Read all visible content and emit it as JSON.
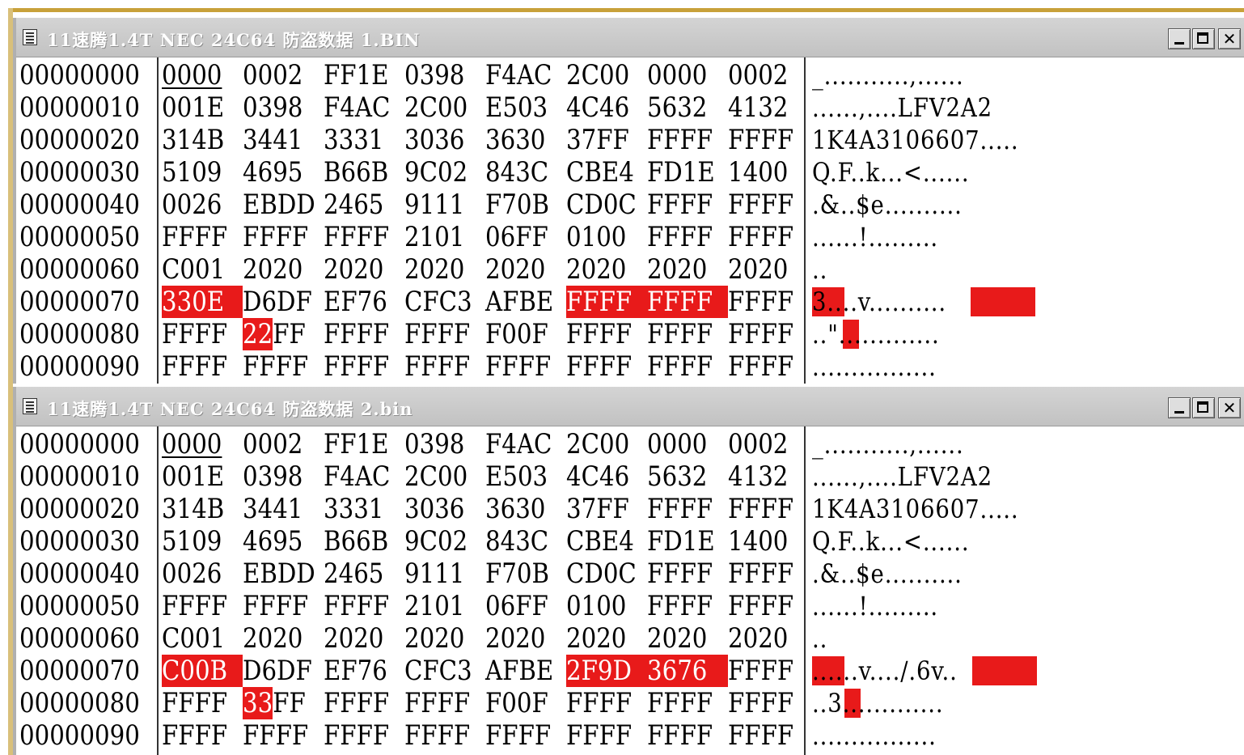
{
  "windows": [
    {
      "title": "11速腾1.4T NEC 24C64 防盗数据 1.BIN",
      "rows": [
        {
          "offset": "00000000",
          "words": [
            "0000",
            "0002",
            "FF1E",
            "0398",
            "F4AC",
            "2C00",
            "0000",
            "0002"
          ],
          "ascii": "_...........,......"
        },
        {
          "offset": "00000010",
          "words": [
            "001E",
            "0398",
            "F4AC",
            "2C00",
            "E503",
            "4C46",
            "5632",
            "4132"
          ],
          "ascii": "......,....LFV2A2"
        },
        {
          "offset": "00000020",
          "words": [
            "314B",
            "3441",
            "3331",
            "3036",
            "3630",
            "37FF",
            "FFFF",
            "FFFF"
          ],
          "ascii": "1K4A3106607....."
        },
        {
          "offset": "00000030",
          "words": [
            "5109",
            "4695",
            "B66B",
            "9C02",
            "843C",
            "CBE4",
            "FD1E",
            "1400"
          ],
          "ascii": "Q.F..k...<......"
        },
        {
          "offset": "00000040",
          "words": [
            "0026",
            "EBDD",
            "2465",
            "9111",
            "F70B",
            "CD0C",
            "FFFF",
            "FFFF"
          ],
          "ascii": ".&..$e.........."
        },
        {
          "offset": "00000050",
          "words": [
            "FFFF",
            "FFFF",
            "FFFF",
            "2101",
            "06FF",
            "0100",
            "FFFF",
            "FFFF"
          ],
          "ascii": "......!........."
        },
        {
          "offset": "00000060",
          "words": [
            "C001",
            "2020",
            "2020",
            "2020",
            "2020",
            "2020",
            "2020",
            "2020"
          ],
          "ascii": ".."
        },
        {
          "offset": "00000070",
          "words": [
            "330E",
            "D6DF",
            "EF76",
            "CFC3",
            "AFBE",
            "FFFF",
            "FFFF",
            "FFFF"
          ],
          "ascii": "3....v.........."
        },
        {
          "offset": "00000080",
          "words": [
            "FFFF",
            "22FF",
            "FFFF",
            "FFFF",
            "F00F",
            "FFFF",
            "FFFF",
            "FFFF"
          ],
          "ascii": "..\"............."
        },
        {
          "offset": "00000090",
          "words": [
            "FFFF",
            "FFFF",
            "FFFF",
            "FFFF",
            "FFFF",
            "FFFF",
            "FFFF",
            "FFFF"
          ],
          "ascii": "................"
        }
      ]
    },
    {
      "title": "11速腾1.4T NEC 24C64 防盗数据 2.bin",
      "rows": [
        {
          "offset": "00000000",
          "words": [
            "0000",
            "0002",
            "FF1E",
            "0398",
            "F4AC",
            "2C00",
            "0000",
            "0002"
          ],
          "ascii": "_...........,......"
        },
        {
          "offset": "00000010",
          "words": [
            "001E",
            "0398",
            "F4AC",
            "2C00",
            "E503",
            "4C46",
            "5632",
            "4132"
          ],
          "ascii": "......,....LFV2A2"
        },
        {
          "offset": "00000020",
          "words": [
            "314B",
            "3441",
            "3331",
            "3036",
            "3630",
            "37FF",
            "FFFF",
            "FFFF"
          ],
          "ascii": "1K4A3106607....."
        },
        {
          "offset": "00000030",
          "words": [
            "5109",
            "4695",
            "B66B",
            "9C02",
            "843C",
            "CBE4",
            "FD1E",
            "1400"
          ],
          "ascii": "Q.F..k...<......"
        },
        {
          "offset": "00000040",
          "words": [
            "0026",
            "EBDD",
            "2465",
            "9111",
            "F70B",
            "CD0C",
            "FFFF",
            "FFFF"
          ],
          "ascii": ".&..$e.........."
        },
        {
          "offset": "00000050",
          "words": [
            "FFFF",
            "FFFF",
            "FFFF",
            "2101",
            "06FF",
            "0100",
            "FFFF",
            "FFFF"
          ],
          "ascii": "......!........."
        },
        {
          "offset": "00000060",
          "words": [
            "C001",
            "2020",
            "2020",
            "2020",
            "2020",
            "2020",
            "2020",
            "2020"
          ],
          "ascii": ".."
        },
        {
          "offset": "00000070",
          "words": [
            "C00B",
            "D6DF",
            "EF76",
            "CFC3",
            "AFBE",
            "2F9D",
            "3676",
            "FFFF"
          ],
          "ascii": "......v..../.6v.."
        },
        {
          "offset": "00000080",
          "words": [
            "FFFF",
            "33FF",
            "FFFF",
            "FFFF",
            "F00F",
            "FFFF",
            "FFFF",
            "FFFF"
          ],
          "ascii": "..3............."
        },
        {
          "offset": "00000090",
          "words": [
            "FFFF",
            "FFFF",
            "FFFF",
            "FFFF",
            "FFFF",
            "FFFF",
            "FFFF",
            "FFFF"
          ],
          "ascii": "................"
        }
      ]
    }
  ],
  "highlight_color": "#e81a1a",
  "title_icon": "document-icon",
  "window_buttons": [
    "minimize-icon",
    "maximize-icon",
    "close-icon"
  ],
  "close_glyph": "✕"
}
